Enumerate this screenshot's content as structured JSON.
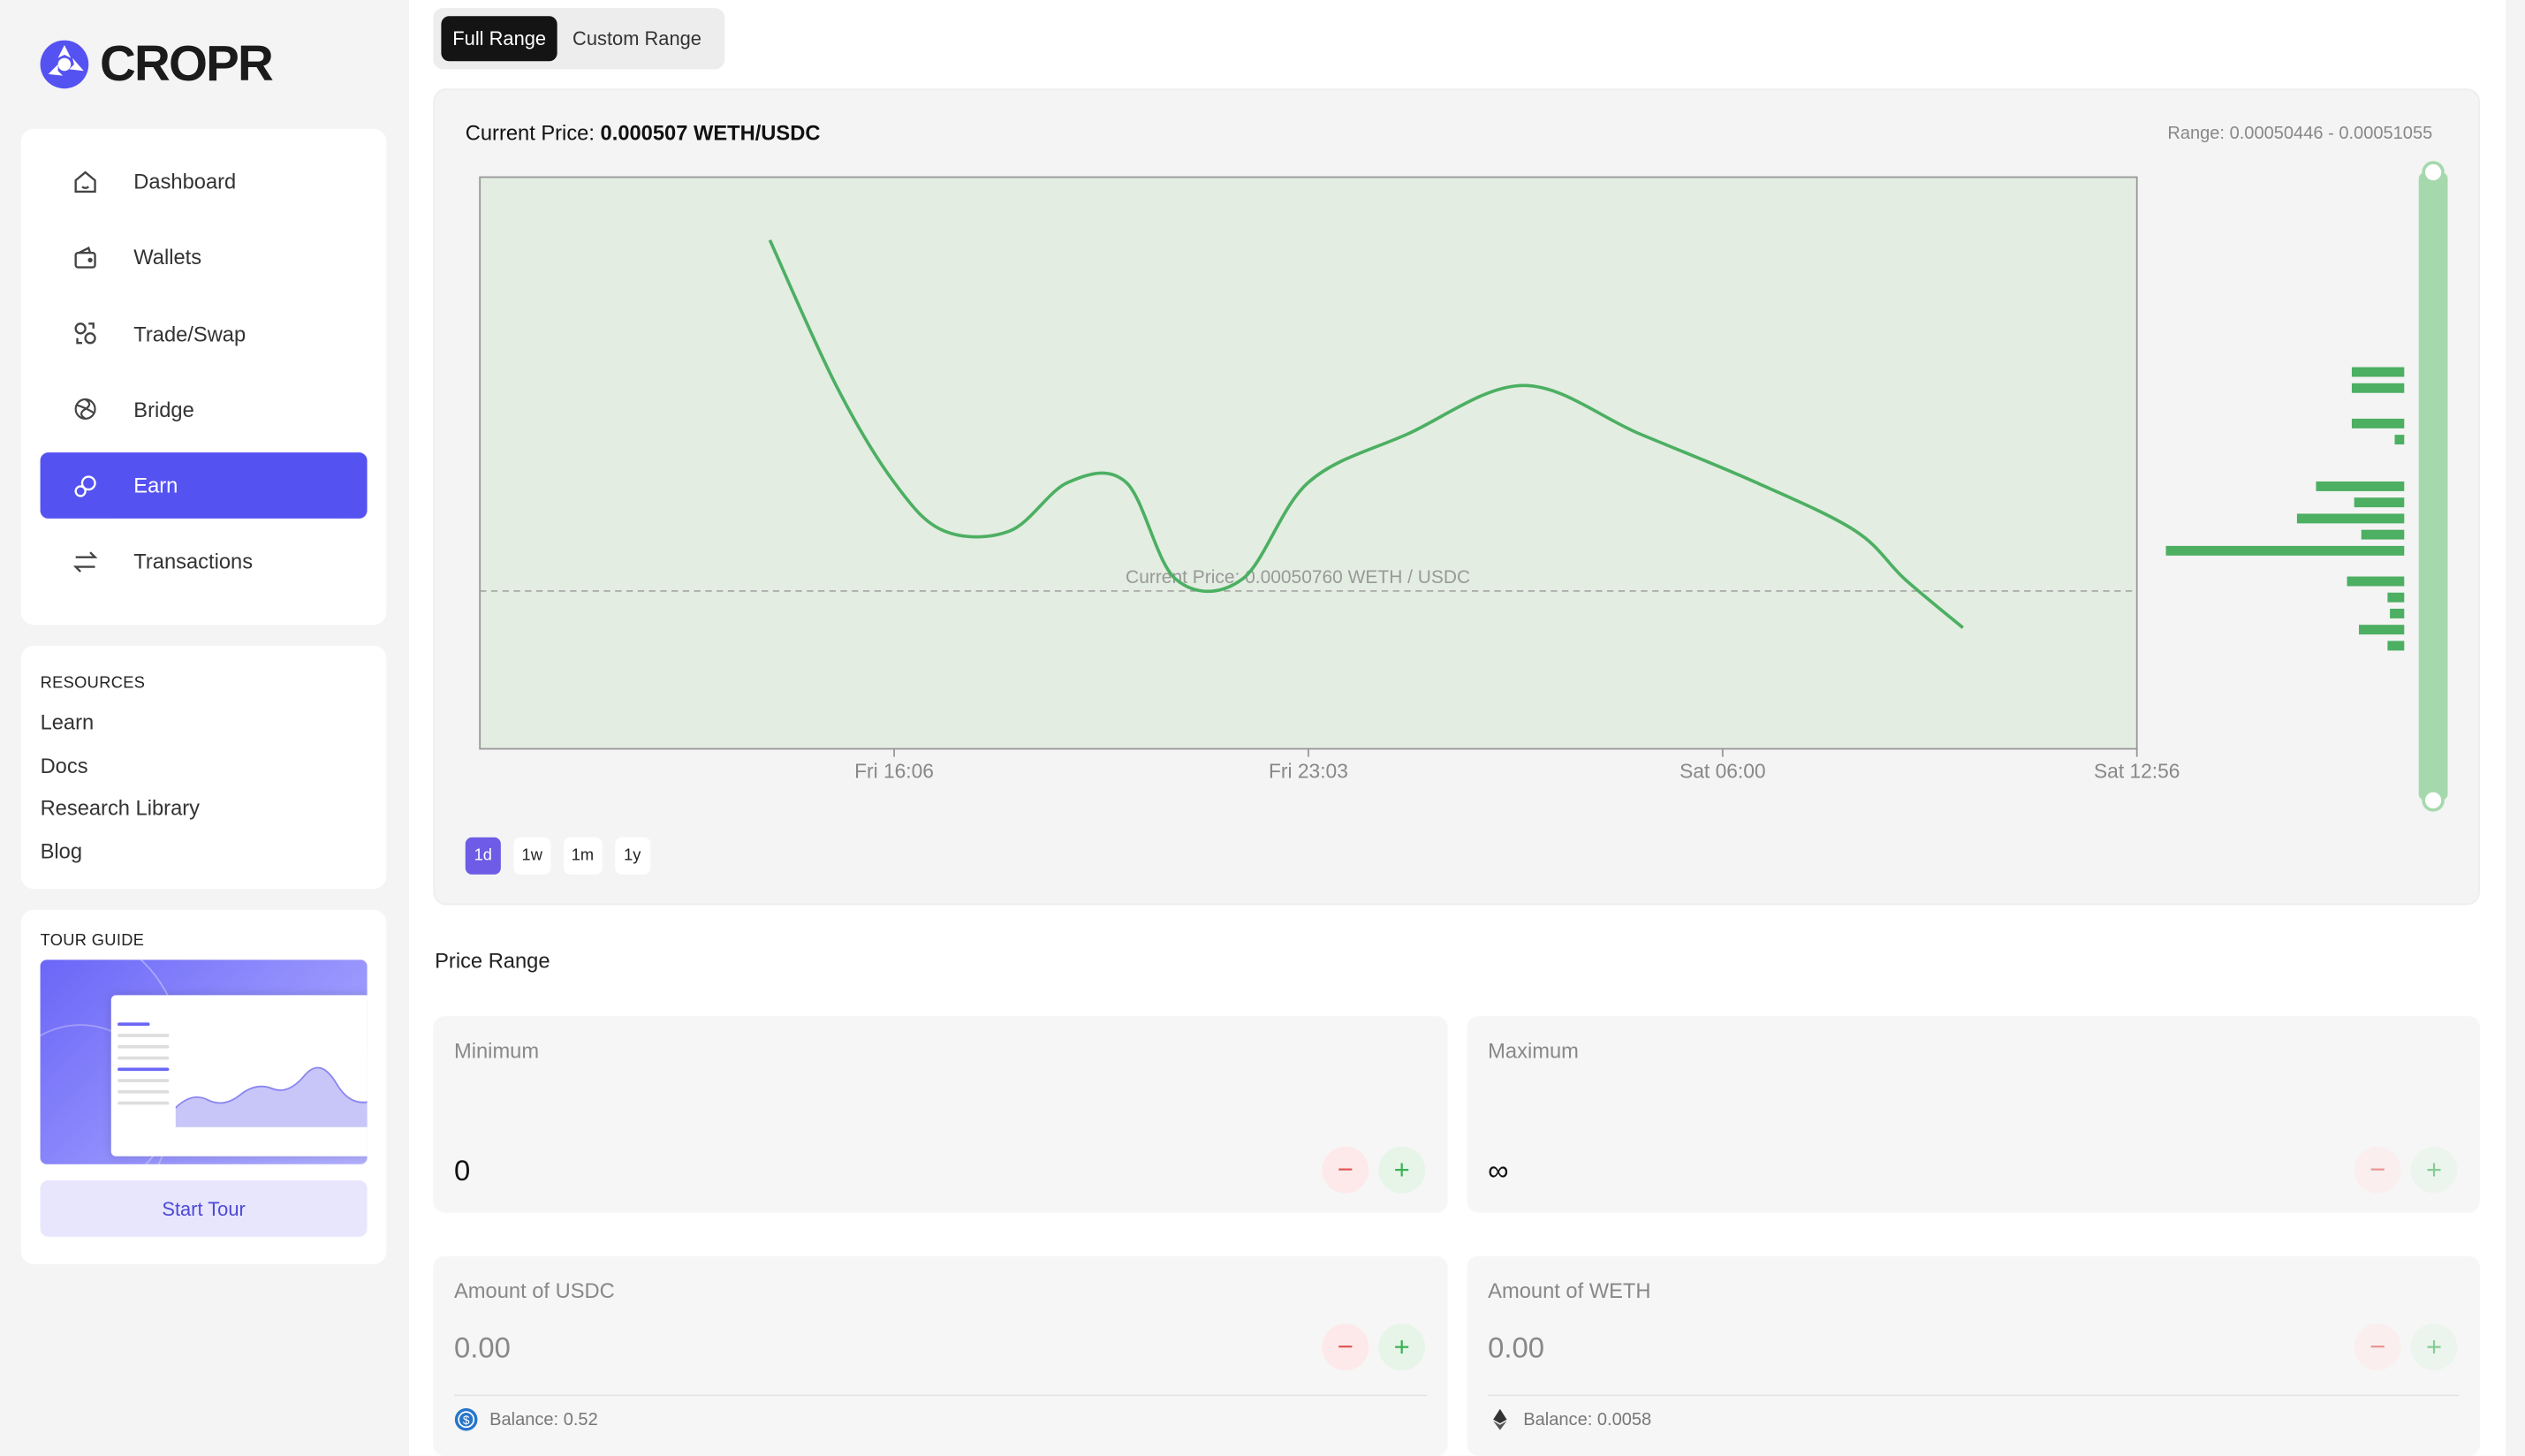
{
  "brand": {
    "name": "CROPR",
    "accent": "#5552f2"
  },
  "nav": [
    {
      "label": "Dashboard",
      "icon": "home-icon",
      "active": false
    },
    {
      "label": "Wallets",
      "icon": "wallet-icon",
      "active": false
    },
    {
      "label": "Trade/Swap",
      "icon": "swap-icon",
      "active": false
    },
    {
      "label": "Bridge",
      "icon": "bridge-icon",
      "active": false
    },
    {
      "label": "Earn",
      "icon": "earn-icon",
      "active": true
    },
    {
      "label": "Transactions",
      "icon": "transactions-icon",
      "active": false
    }
  ],
  "resources": {
    "title": "RESOURCES",
    "links": [
      "Learn",
      "Docs",
      "Research Library",
      "Blog"
    ]
  },
  "tour": {
    "title": "TOUR GUIDE",
    "button": "Start Tour"
  },
  "range_toggle": {
    "options": [
      "Full Range",
      "Custom Range"
    ],
    "selected": "Full Range"
  },
  "price_header": {
    "prefix": "Current Price:",
    "value": "0.000507 WETH/USDC",
    "range": "Range: 0.00050446 - 0.00051055"
  },
  "chart_data": {
    "type": "line",
    "x_ticks": [
      "Fri 16:06",
      "Fri 23:03",
      "Sat 06:00",
      "Sat 12:56"
    ],
    "reference_line": {
      "label": "Current Price: 0.00050760 WETH / USDC",
      "value": 0.0005076
    },
    "series": [
      {
        "color": "#4caf62",
        "x": [
          0.175,
          0.215,
          0.25,
          0.28,
          0.32,
          0.355,
          0.39,
          0.42,
          0.46,
          0.5,
          0.56,
          0.63,
          0.7,
          0.77,
          0.83,
          0.86,
          0.895
        ],
        "y": [
          0.000513,
          0.00051,
          0.000508,
          0.000507,
          0.000507,
          0.000508,
          0.000508,
          0.000506,
          0.000506,
          0.000508,
          0.000509,
          0.00051,
          0.000509,
          0.000508,
          0.000507,
          0.000506,
          0.000505
        ]
      }
    ],
    "histogram": [
      0.22,
      0.22,
      0.22,
      0.04,
      0.37,
      0.21,
      0.45,
      0.18,
      1.0,
      0.24,
      0.07,
      0.06,
      0.19,
      0.07
    ],
    "grid": false
  },
  "periods": {
    "options": [
      "1d",
      "1w",
      "1m",
      "1y"
    ],
    "selected": "1d"
  },
  "price_range": {
    "title": "Price Range",
    "minimum": {
      "label": "Minimum",
      "value": "0"
    },
    "maximum": {
      "label": "Maximum",
      "value": "∞"
    }
  },
  "amounts": {
    "usdc": {
      "label": "Amount of USDC",
      "value": "0.00",
      "balance": "Balance: 0.52"
    },
    "weth": {
      "label": "Amount of WETH",
      "value": "0.00",
      "balance": "Balance: 0.0058"
    }
  },
  "colors": {
    "chart_bg": "#e3ede1",
    "line": "#4caf62",
    "minus": "#e25656",
    "plus": "#3cb155"
  }
}
